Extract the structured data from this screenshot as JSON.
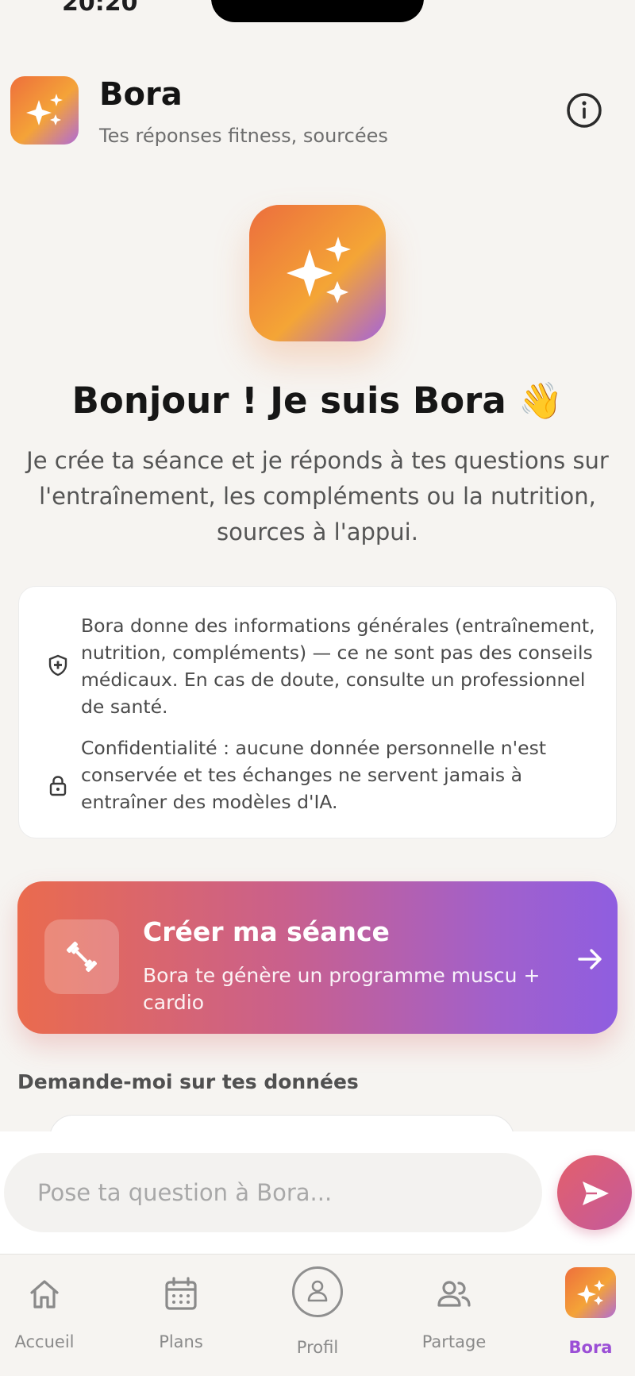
{
  "status_bar": {
    "time": "20:20"
  },
  "header": {
    "logo_icon": "sparkles-icon",
    "app_name": "Bora",
    "tagline": "Tes réponses fitness, sourcées",
    "info_icon": "info-icon"
  },
  "hero": {
    "logo_icon": "sparkles-icon",
    "greeting": "Bonjour ! Je suis Bora 👋",
    "intro": "Je crée ta séance et je réponds à tes questions sur l'entraînement, les compléments ou la nutrition, sources à l'appui."
  },
  "notices": [
    {
      "icon": "shield-plus-icon",
      "text": "Bora donne des informations générales (entraînement, nutrition, compléments) — ce ne sont pas des conseils médicaux. En cas de doute, consulte un professionnel de santé."
    },
    {
      "icon": "lock-icon",
      "text": "Confidentialité : aucune donnée personnelle n'est conservée et tes échanges ne servent jamais à entraîner des modèles d'IA."
    }
  ],
  "cta": {
    "icon": "dumbbell-icon",
    "title": "Créer ma séance",
    "subtitle": "Bora te génère un programme muscu + cardio",
    "arrow_icon": "arrow-right-icon"
  },
  "section": {
    "label": "Demande-moi sur tes données"
  },
  "composer": {
    "placeholder": "Pose ta question à Bora...",
    "send_icon": "send-icon"
  },
  "tabs": [
    {
      "label": "Accueil",
      "icon": "home-icon",
      "active": false
    },
    {
      "label": "Plans",
      "icon": "calendar-icon",
      "active": false
    },
    {
      "label": "Profil",
      "icon": "user-icon",
      "active": false
    },
    {
      "label": "Partage",
      "icon": "users-icon",
      "active": false
    },
    {
      "label": "Bora",
      "icon": "sparkles-icon",
      "active": true
    }
  ],
  "colors": {
    "background": "#f6f4f1",
    "accent_orange": "#ee6f3c",
    "accent_purple": "#9b4fd6",
    "card": "#ffffff"
  }
}
